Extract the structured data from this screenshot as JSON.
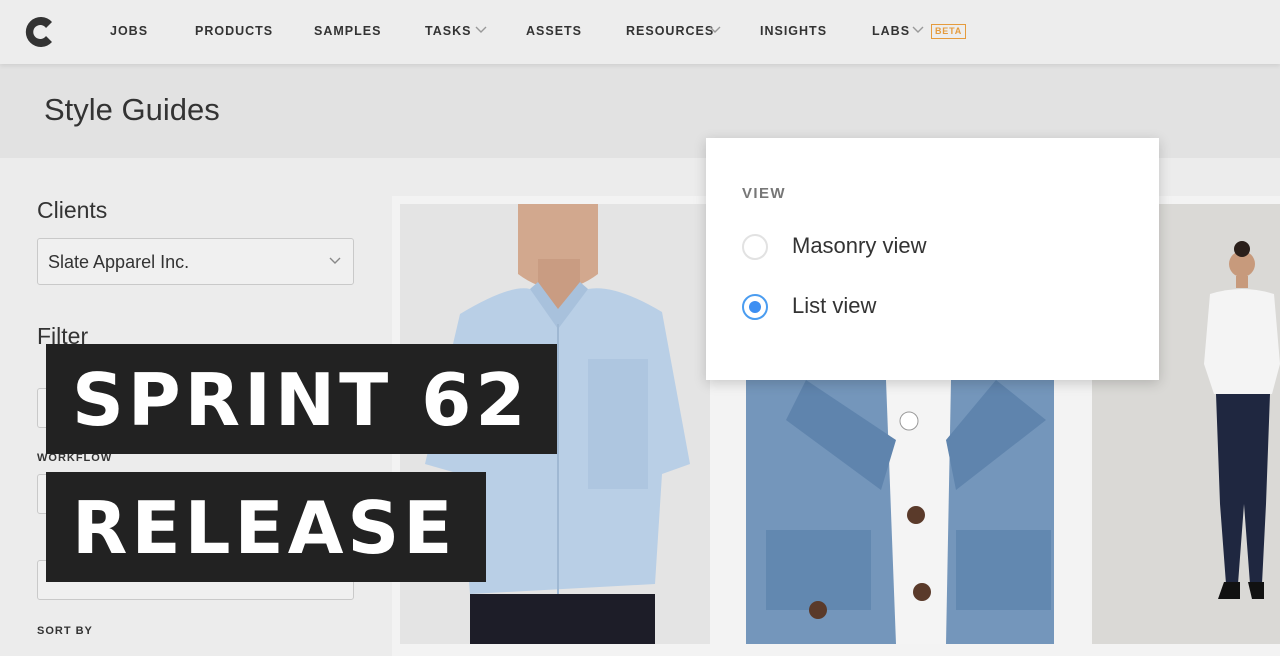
{
  "nav": {
    "items": [
      {
        "label": "JOBS"
      },
      {
        "label": "PRODUCTS"
      },
      {
        "label": "SAMPLES"
      },
      {
        "label": "TASKS"
      },
      {
        "label": "ASSETS"
      },
      {
        "label": "RESOURCES"
      },
      {
        "label": "INSIGHTS"
      },
      {
        "label": "LABS"
      }
    ],
    "beta_label": "BETA"
  },
  "page": {
    "title": "Style Guides"
  },
  "sidebar": {
    "clients_heading": "Clients",
    "client_value": "Slate Apparel Inc.",
    "filter_heading": "Filter",
    "workflow_label": "WORKFLOW",
    "sort_label": "SORT BY"
  },
  "view_popup": {
    "heading": "VIEW",
    "options": [
      {
        "label": "Masonry view",
        "selected": false
      },
      {
        "label": "List view",
        "selected": true
      }
    ]
  },
  "banner": {
    "line1": "SPRINT 62",
    "line2": "RELEASE"
  },
  "colors": {
    "accent": "#3d8ff2",
    "beta": "#e59b3d",
    "banner_bg": "#222222"
  }
}
